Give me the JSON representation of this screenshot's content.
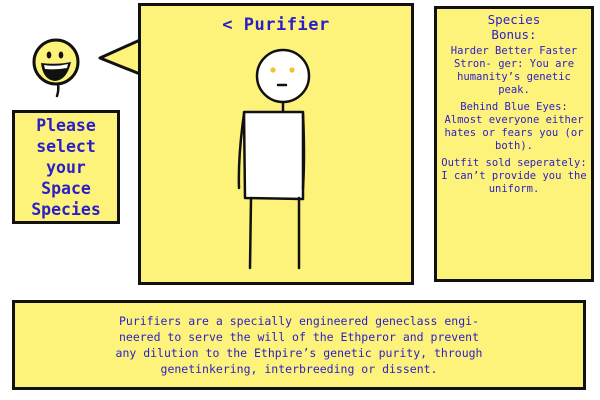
{
  "prompt": {
    "lines": [
      "Please",
      "select",
      "your",
      "Space",
      "Species"
    ]
  },
  "species": {
    "back_glyph": "<",
    "name": "Purifier"
  },
  "bonus": {
    "heading_lines": [
      "Species",
      "Bonus:"
    ],
    "paragraphs": [
      "Harder Better Faster Stron- ger: You are humanity’s genetic peak.",
      "Behind Blue Eyes: Almost everyone either hates or fears you (or both).",
      "Outfit sold seperately: I can’t provide you the uniform."
    ]
  },
  "description": {
    "lines": [
      "Purifiers are a specially engineered geneclass engi-",
      "neered to serve the will of the Ethperor and prevent",
      "any dilution to the Ethpire’s genetic purity, through",
      "genetinkering, interbreeding or dissent."
    ]
  },
  "colors": {
    "panel_fill": "#fdf27a",
    "text_blue": "#2a1fc7",
    "outline": "#111111",
    "eye_yellow": "#f2c230"
  }
}
